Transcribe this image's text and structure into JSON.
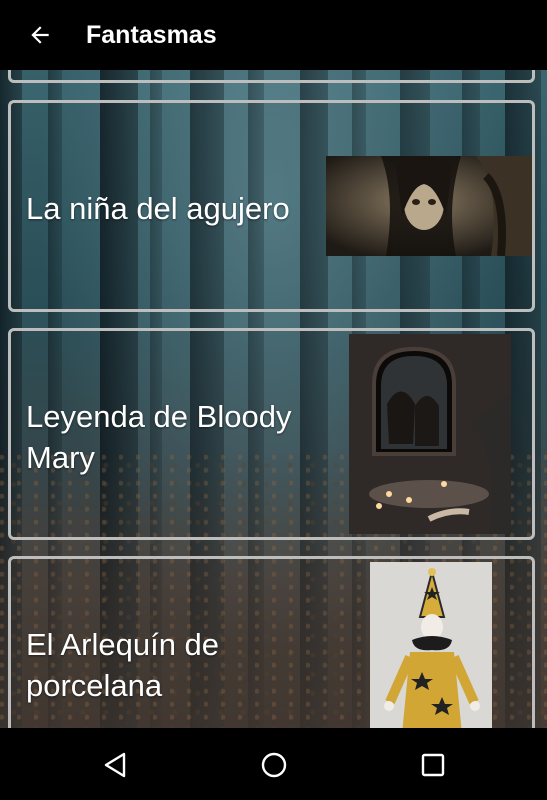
{
  "app_bar": {
    "title": "Fantasmas",
    "back_icon": "arrow-back-icon"
  },
  "stories": [
    {
      "title": "La niña del agujero",
      "thumbnail": "girl-in-hole-thumbnail"
    },
    {
      "title": "Leyenda de Bloody Mary",
      "thumbnail": "mirror-candles-thumbnail"
    },
    {
      "title": "El Arlequín de porcelana",
      "thumbnail": "harlequin-doll-thumbnail"
    }
  ],
  "nav_bar": {
    "back_icon": "triangle-back-icon",
    "home_icon": "circle-home-icon",
    "recents_icon": "square-recents-icon"
  },
  "colors": {
    "app_bar": "#000000",
    "card_border": "#bdbdbd",
    "text": "#ffffff",
    "forest_teal": "#2d545e"
  }
}
